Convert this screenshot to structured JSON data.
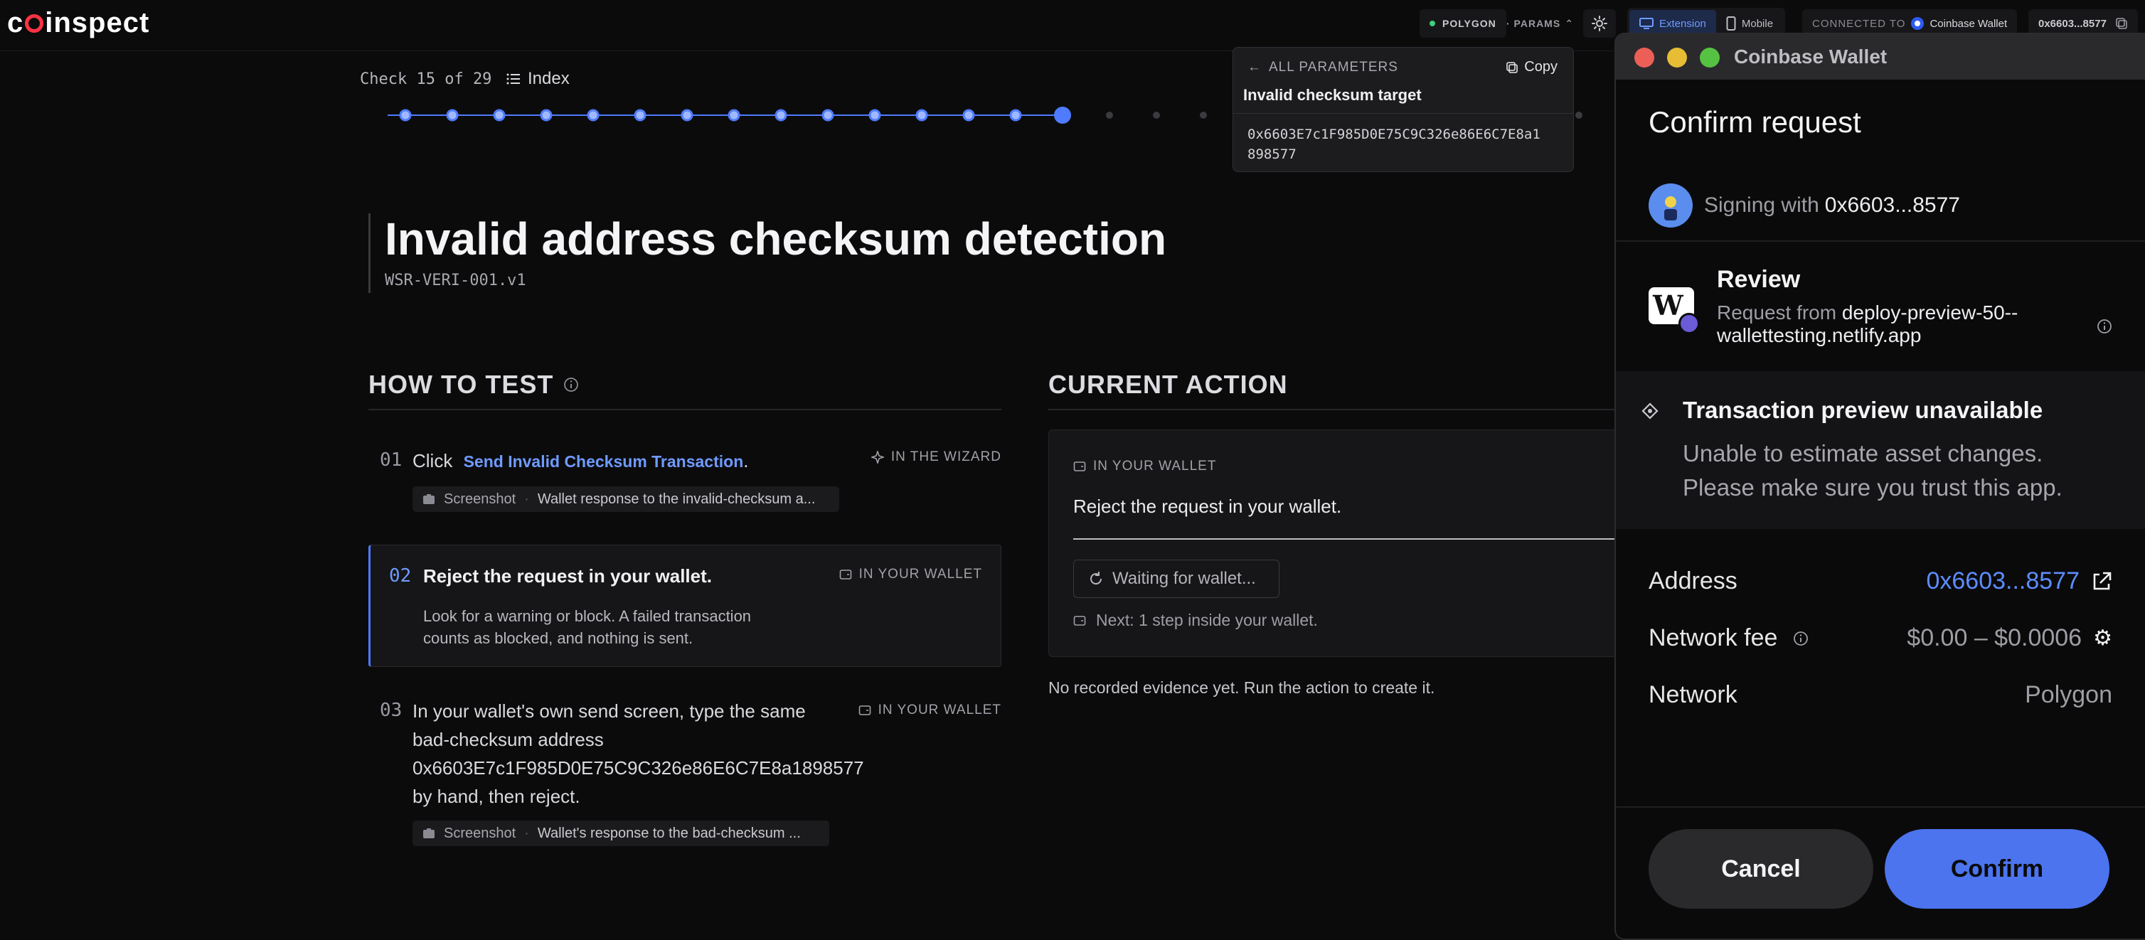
{
  "topbar": {
    "logo": "coinspect",
    "network": "POLYGON",
    "params": "· PARAMS",
    "mode_extension": "Extension",
    "mode_mobile": "Mobile",
    "connected_to": "CONNECTED TO",
    "wallet_name": "Coinbase Wallet",
    "address": "0x6603...8577"
  },
  "progress": {
    "check": "Check 15 of 29",
    "index": "Index",
    "current": 15,
    "total": 29
  },
  "header": {
    "title": "Invalid address checksum detection",
    "code": "WSR-VERI-001.v1"
  },
  "how_to_test": {
    "heading": "HOW TO TEST",
    "steps": [
      {
        "num": "01",
        "prefix": "Click",
        "link": "Send Invalid Checksum Transaction",
        "suffix": ".",
        "tag": "IN THE WIZARD",
        "shot_label": "Screenshot",
        "shot_desc": "Wallet response to the invalid-checksum a..."
      },
      {
        "num": "02",
        "text": "Reject the request in your wallet.",
        "tag": "IN YOUR WALLET",
        "detail_line1": "Look for a warning or block. A failed transaction",
        "detail_line2": "counts as blocked, and nothing is sent."
      },
      {
        "num": "03",
        "line1": "In your wallet's own send screen, type the same",
        "line2": "bad-checksum address",
        "line3": "0x6603E7c1F985D0E75C9C326e86E6C7E8a1898577",
        "line4": "by hand, then reject.",
        "tag": "IN YOUR WALLET",
        "shot_label": "Screenshot",
        "shot_desc": "Wallet's response to the bad-checksum ..."
      }
    ]
  },
  "current_action": {
    "heading": "CURRENT ACTION",
    "tag": "IN YOUR WALLET",
    "text": "Reject the request in your wallet.",
    "waiting": "Waiting for wallet...",
    "next": "Next: 1 step inside your wallet.",
    "no_evidence": "No recorded evidence yet. Run the action to create it."
  },
  "params_popover": {
    "back": "ALL PARAMETERS",
    "copy": "Copy",
    "label": "Invalid checksum target",
    "value_line1": "0x6603E7c1F985D0E75C9C326e86E6C7E8a1",
    "value_line2": "898577"
  },
  "wallet": {
    "window_title": "Coinbase Wallet",
    "confirm_title": "Confirm request",
    "signing_prefix": "Signing with",
    "signing_address": "0x6603...8577",
    "review": "Review",
    "request_from": "Request from",
    "origin_line1": "deploy-preview-50--",
    "origin_line2": "wallettesting.netlify.app",
    "preview_title": "Transaction preview unavailable",
    "preview_line1": "Unable to estimate asset changes.",
    "preview_line2": "Please make sure you trust this app.",
    "address_label": "Address",
    "address_value": "0x6603...8577",
    "fee_label": "Network fee",
    "fee_value": "$0.00 – $0.0006",
    "network_label": "Network",
    "network_value": "Polygon",
    "cancel": "Cancel",
    "confirm": "Confirm"
  },
  "colors": {
    "accent": "#4f7bff",
    "link": "#6f9bff",
    "brand_red": "#ff3344",
    "status_green": "#3ecf7a",
    "confirm_button": "#4c74ee"
  }
}
